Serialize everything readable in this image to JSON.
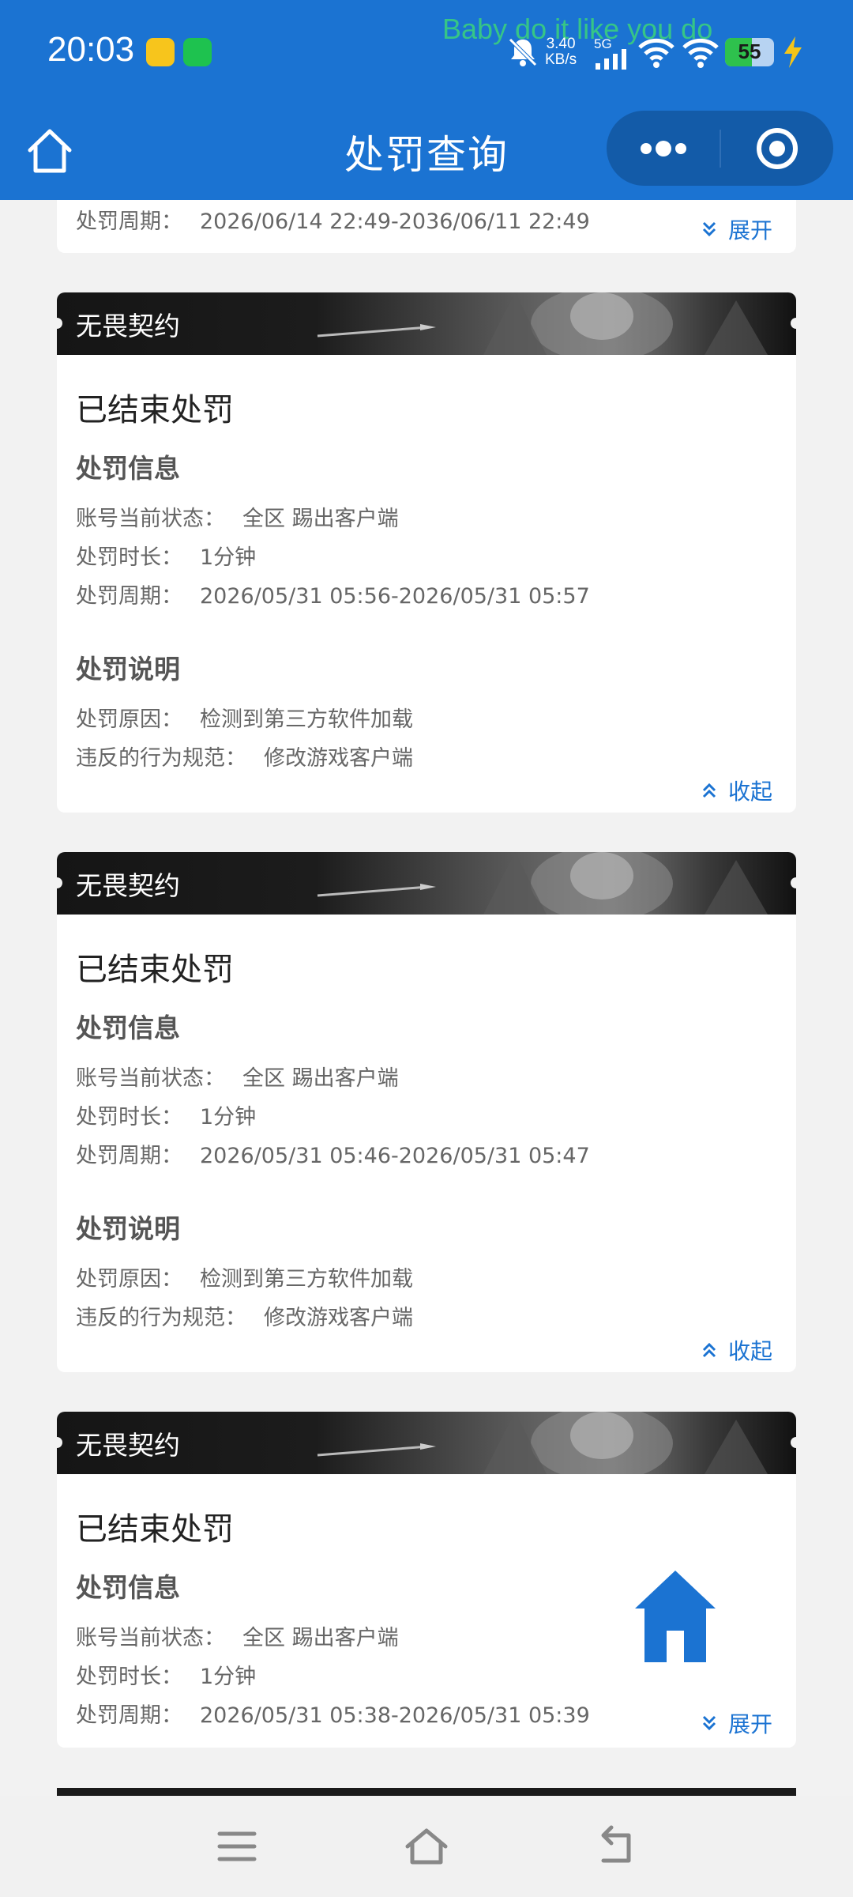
{
  "status_bar": {
    "time": "20:03",
    "lyric": "Baby do it like you do",
    "net_speed_value": "3.40",
    "net_speed_unit": "KB/s",
    "network": "5G",
    "battery_text": "55",
    "battery_level": 0.55,
    "battery_color": "#2ec14d"
  },
  "navbar": {
    "title": "处罚查询"
  },
  "theme": {
    "primary": "#1b73d2",
    "link": "#1b73d2"
  },
  "partial_card": {
    "period_label": "处罚周期：",
    "period_value": "2026/06/14 22:49-2036/06/11 22:49",
    "toggle_label": "展开"
  },
  "cards": [
    {
      "game": "无畏契约",
      "status": "已结束处罚",
      "info_title": "处罚信息",
      "state_label": "账号当前状态：",
      "state_value": "全区 踢出客户端",
      "duration_label": "处罚时长：",
      "duration_value": "1分钟",
      "period_label": "处罚周期：",
      "period_value": "2026/05/31 05:56-2026/05/31 05:57",
      "desc_title": "处罚说明",
      "reason_label": "处罚原因：",
      "reason_value": "检测到第三方软件加载",
      "rule_label": "违反的行为规范：",
      "rule_value": "修改游戏客户端",
      "toggle_label": "收起"
    },
    {
      "game": "无畏契约",
      "status": "已结束处罚",
      "info_title": "处罚信息",
      "state_label": "账号当前状态：",
      "state_value": "全区 踢出客户端",
      "duration_label": "处罚时长：",
      "duration_value": "1分钟",
      "period_label": "处罚周期：",
      "period_value": "2026/05/31 05:46-2026/05/31 05:47",
      "desc_title": "处罚说明",
      "reason_label": "处罚原因：",
      "reason_value": "检测到第三方软件加载",
      "rule_label": "违反的行为规范：",
      "rule_value": "修改游戏客户端",
      "toggle_label": "收起"
    },
    {
      "game": "无畏契约",
      "status": "已结束处罚",
      "info_title": "处罚信息",
      "state_label": "账号当前状态：",
      "state_value": "全区 踢出客户端",
      "duration_label": "处罚时长：",
      "duration_value": "1分钟",
      "period_label": "处罚周期：",
      "period_value": "2026/05/31 05:38-2026/05/31 05:39",
      "toggle_label": "展开"
    }
  ]
}
